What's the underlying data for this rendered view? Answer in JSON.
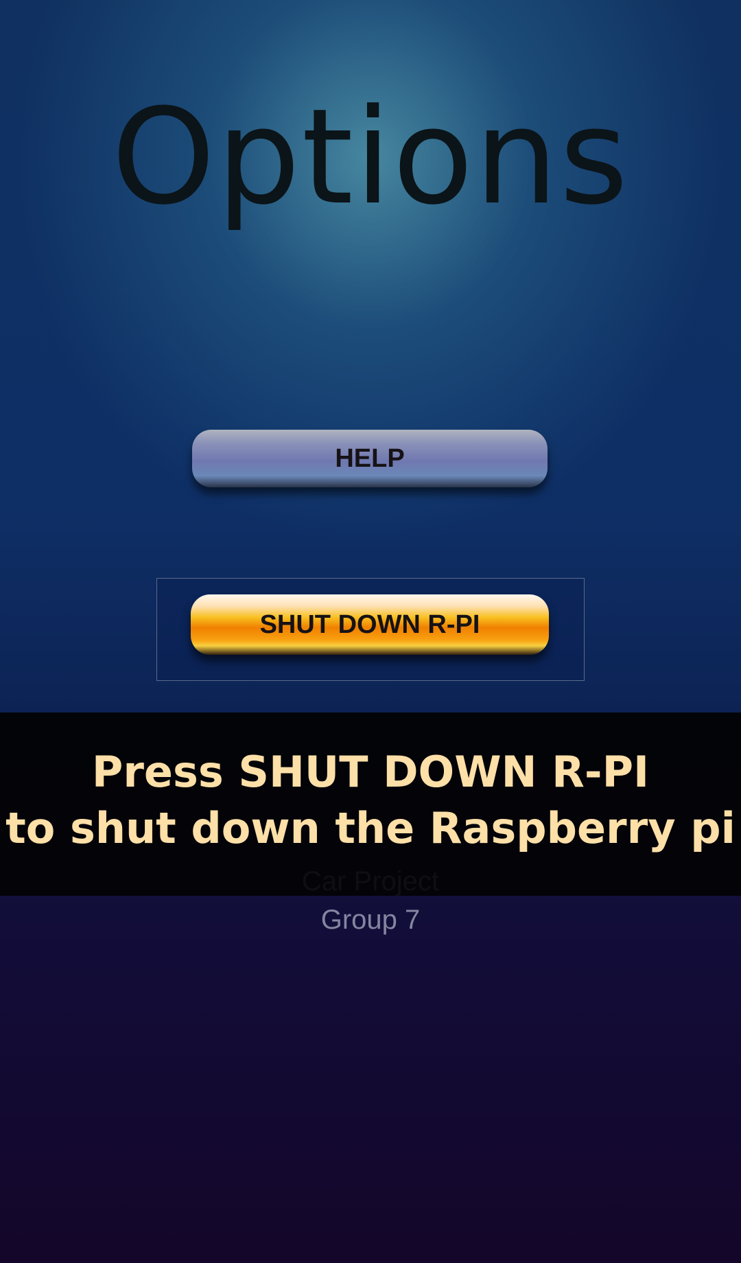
{
  "header": {
    "title": "Options"
  },
  "buttons": {
    "help": "HELP",
    "shutdown": "SHUT DOWN  R-PI"
  },
  "toast": {
    "line1": "Press SHUT DOWN R-PI",
    "line2": "to shut down the Raspberry pi",
    "text_color": "#fddfa8"
  },
  "footer": {
    "project": "Car Project",
    "group": "Group 7"
  }
}
